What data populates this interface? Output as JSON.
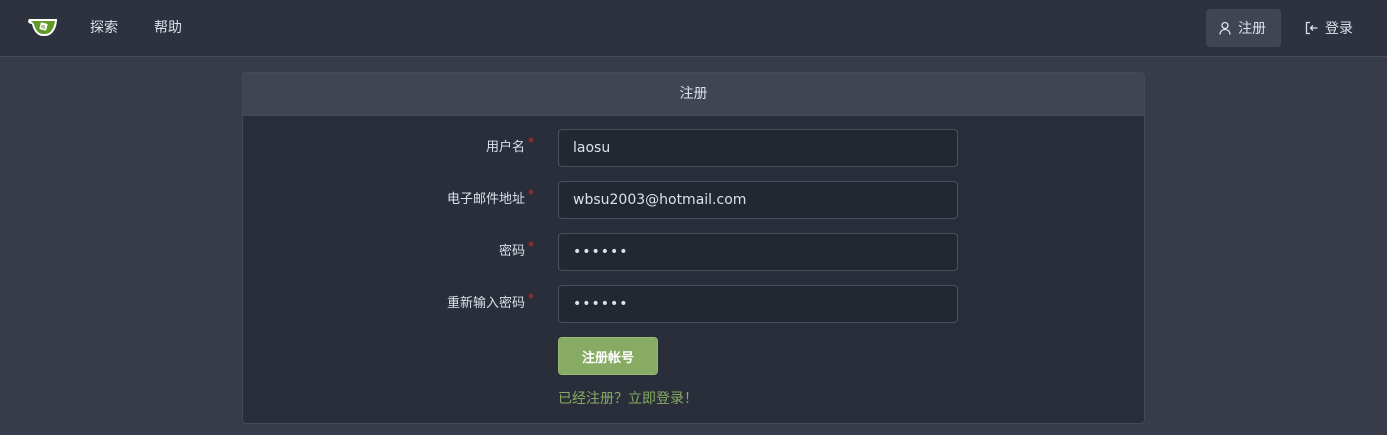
{
  "nav": {
    "explore": "探索",
    "help": "帮助",
    "register": "注册",
    "login": "登录"
  },
  "panel": {
    "title": "注册"
  },
  "form": {
    "fields": [
      {
        "label": "用户名",
        "required_mark": "*",
        "value": "laosu",
        "type": "text"
      },
      {
        "label": "电子邮件地址",
        "required_mark": "*",
        "value": "wbsu2003@hotmail.com",
        "type": "email"
      },
      {
        "label": "密码",
        "required_mark": "*",
        "value": "••••••",
        "type": "password"
      },
      {
        "label": "重新输入密码",
        "required_mark": "*",
        "value": "••••••",
        "type": "password"
      }
    ],
    "submit_label": "注册帐号",
    "login_prompt": "已经注册？立即登录！"
  },
  "colors": {
    "accent": "#87ab63",
    "background": "#383c4a",
    "navbar": "#2e323e",
    "required": "#db2828"
  },
  "icons": {
    "logo": "gitea-tea-cup-logo",
    "register": "user-icon",
    "login": "sign-in-icon"
  }
}
